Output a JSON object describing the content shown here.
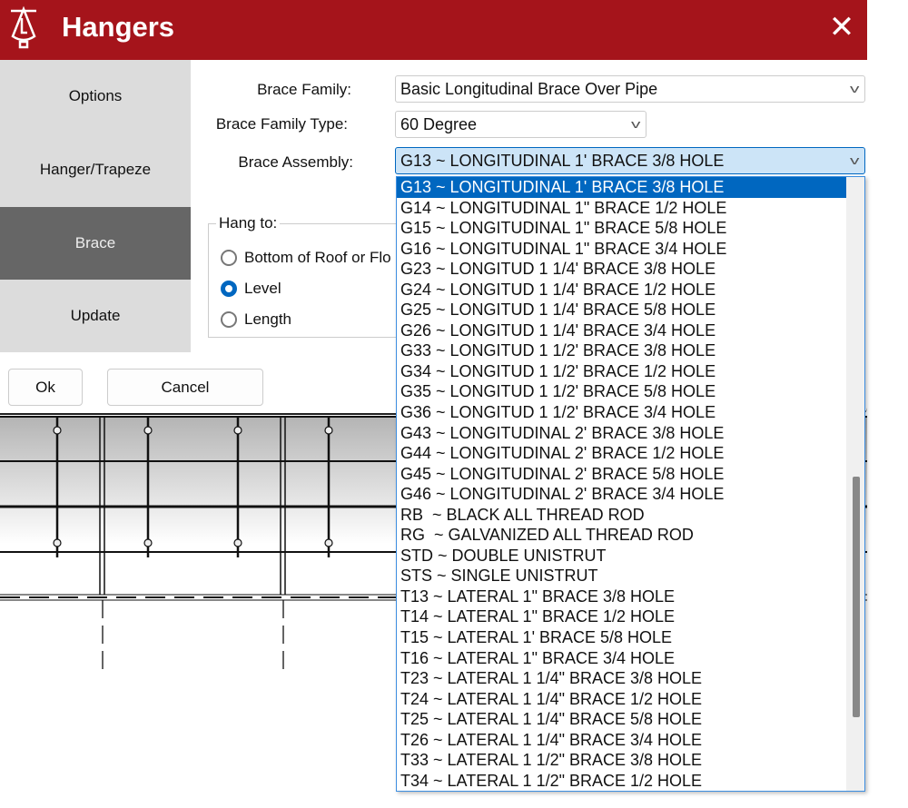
{
  "window": {
    "title": "Hangers",
    "close_icon": "close-icon",
    "logo_icon": "hanger-logo"
  },
  "nav": {
    "items": [
      {
        "label": "Options"
      },
      {
        "label": "Hanger/Trapeze"
      },
      {
        "label": "Brace",
        "active": true
      },
      {
        "label": "Update"
      }
    ]
  },
  "form": {
    "brace_family_label": "Brace Family:",
    "brace_family_value": "Basic Longitudinal Brace Over Pipe",
    "brace_family_type_label": "Brace Family Type:",
    "brace_family_type_value": "60 Degree",
    "brace_assembly_label": "Brace Assembly:",
    "brace_assembly_value": "G13 ~ LONGITUDINAL 1' BRACE 3/8 HOLE",
    "hang_to": {
      "title": "Hang to:",
      "options": [
        {
          "label": "Bottom of Roof or Flo",
          "checked": false
        },
        {
          "label": "Level",
          "checked": true
        },
        {
          "label": "Length",
          "checked": false
        }
      ]
    }
  },
  "buttons": {
    "ok": "Ok",
    "cancel": "Cancel"
  },
  "dropdown": {
    "selected_index": 0,
    "scroll_fraction": 0.7,
    "options": [
      "G13 ~ LONGITUDINAL 1' BRACE 3/8 HOLE",
      "G14 ~ LONGITUDINAL 1\" BRACE 1/2 HOLE",
      "G15 ~ LONGITUDINAL 1\" BRACE 5/8 HOLE",
      "G16 ~ LONGITUDINAL 1\" BRACE 3/4 HOLE",
      "G23 ~ LONGITUD 1 1/4' BRACE 3/8 HOLE",
      "G24 ~ LONGITUD 1 1/4' BRACE 1/2 HOLE",
      "G25 ~ LONGITUD 1 1/4' BRACE 5/8 HOLE",
      "G26 ~ LONGITUD 1 1/4' BRACE 3/4 HOLE",
      "G33 ~ LONGITUD 1 1/2' BRACE 3/8 HOLE",
      "G34 ~ LONGITUD 1 1/2' BRACE 1/2 HOLE",
      "G35 ~ LONGITUD 1 1/2' BRACE 5/8 HOLE",
      "G36 ~ LONGITUD 1 1/2' BRACE 3/4 HOLE",
      "G43 ~ LONGITUDINAL 2' BRACE 3/8 HOLE",
      "G44 ~ LONGITUDINAL 2' BRACE 1/2 HOLE",
      "G45 ~ LONGITUDINAL 2' BRACE 5/8 HOLE",
      "G46 ~ LONGITUDINAL 2' BRACE 3/4 HOLE",
      "RB  ~ BLACK ALL THREAD ROD",
      "RG  ~ GALVANIZED ALL THREAD ROD",
      "STD ~ DOUBLE UNISTRUT",
      "STS ~ SINGLE UNISTRUT",
      "T13 ~ LATERAL 1\" BRACE 3/8 HOLE",
      "T14 ~ LATERAL 1\" BRACE 1/2 HOLE",
      "T15 ~ LATERAL 1' BRACE 5/8 HOLE",
      "T16 ~ LATERAL 1\" BRACE 3/4 HOLE",
      "T23 ~ LATERAL 1 1/4\" BRACE 3/8 HOLE",
      "T24 ~ LATERAL 1 1/4\" BRACE 1/2 HOLE",
      "T25 ~ LATERAL 1 1/4\" BRACE 5/8 HOLE",
      "T26 ~ LATERAL 1 1/4\" BRACE 3/4 HOLE",
      "T33 ~ LATERAL 1 1/2\" BRACE 3/8 HOLE",
      "T34 ~ LATERAL 1 1/2\" BRACE 1/2 HOLE"
    ]
  },
  "colors": {
    "titlebar": "#a5141b",
    "selection": "#0067c0",
    "nav_active": "#666666"
  }
}
